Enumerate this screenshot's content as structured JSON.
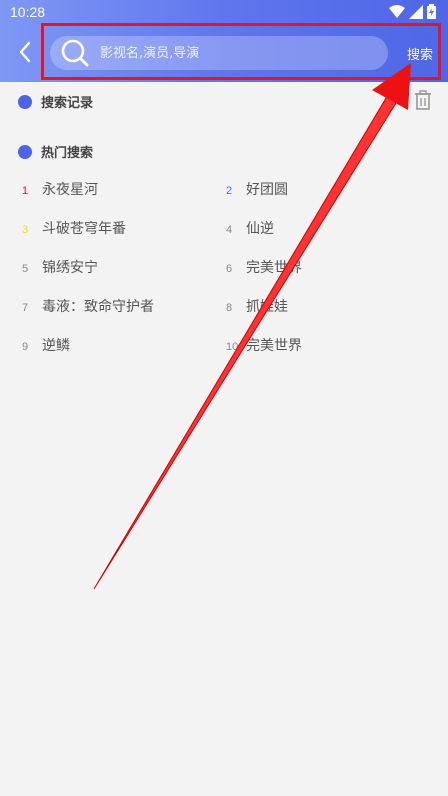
{
  "status_bar": {
    "time": "10:28"
  },
  "header": {
    "search_placeholder": "影视名,演员,导演",
    "search_button": "搜索"
  },
  "history": {
    "title": "搜索记录"
  },
  "hot": {
    "title": "热门搜索",
    "items": [
      {
        "num": "1",
        "label": "永夜星河",
        "color": "#e0162b"
      },
      {
        "num": "2",
        "label": "好团圆",
        "color": "#4c65e6"
      },
      {
        "num": "3",
        "label": "斗破苍穹年番",
        "color": "#f2d90c"
      },
      {
        "num": "4",
        "label": "仙逆",
        "color": "#888888"
      },
      {
        "num": "5",
        "label": "锦绣安宁",
        "color": "#888888"
      },
      {
        "num": "6",
        "label": "完美世界",
        "color": "#888888"
      },
      {
        "num": "7",
        "label": "毒液：致命守护者",
        "color": "#888888"
      },
      {
        "num": "8",
        "label": "抓娃娃",
        "color": "#888888"
      },
      {
        "num": "9",
        "label": "逆鳞",
        "color": "#888888"
      },
      {
        "num": "10",
        "label": "完美世界",
        "color": "#888888"
      }
    ]
  },
  "colors": {
    "accent": "#4c65e6",
    "annotation": "#e0162b"
  }
}
